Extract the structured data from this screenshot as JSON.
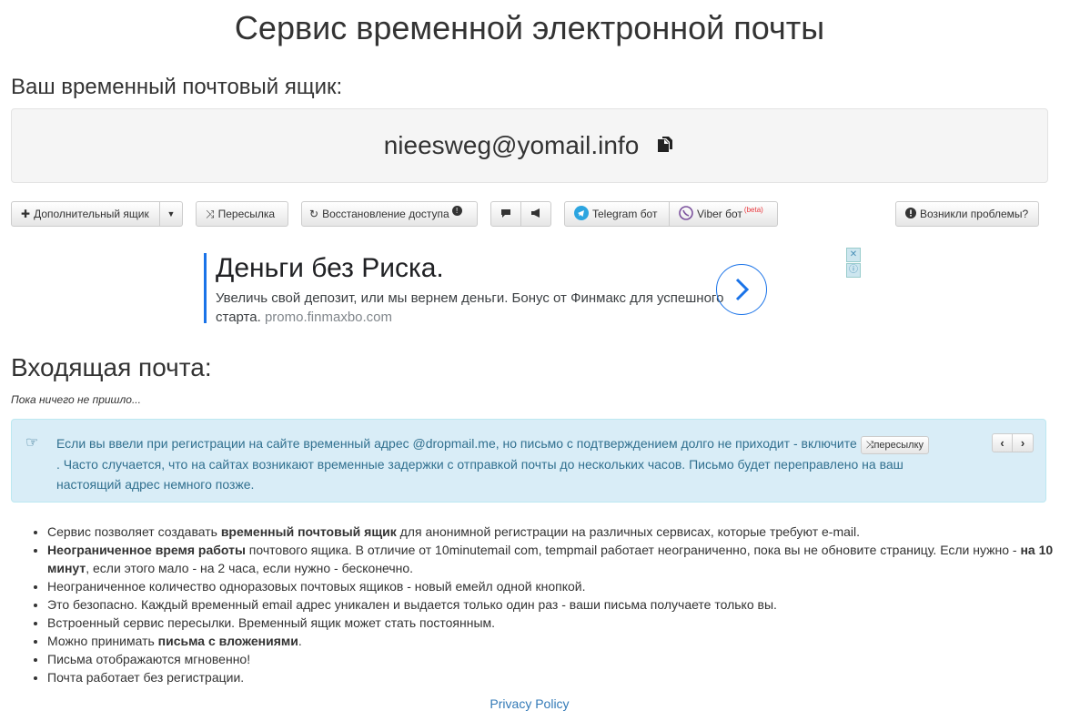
{
  "page": {
    "title": "Сервис временной электронной почты"
  },
  "mailbox": {
    "heading": "Ваш временный почтовый ящик:",
    "address": "nieesweg@yomail.info",
    "copy_icon": "copy-icon"
  },
  "toolbar": {
    "additional_box": "Дополнительный ящик",
    "forwarding": "Пересылка",
    "restore_access": "Восстановление доступа",
    "restore_badge": "!",
    "telegram_bot": "Telegram бот",
    "viber_bot": "Viber бот",
    "viber_beta": "(beta)",
    "problems": "Возникли проблемы?"
  },
  "ad": {
    "headline": "Деньги без Риска.",
    "body": "Увеличь свой депозит, или мы вернем деньги. Бонус от Финмакс для успешного старта.",
    "url": "promo.finmaxbo.com",
    "close_icon": "✕",
    "info_icon": "ⓘ"
  },
  "inbox": {
    "heading": "Входящая почта:",
    "empty_text": "Пока ничего не пришло..."
  },
  "info": {
    "text_before": "Если вы ввели при регистрации на сайте временный адрес @dropmail.me, но письмо с подтверждением долго не приходит - включите",
    "inline_button": "пересылку",
    "text_after": ". Часто случается, что на сайтах возникают временные задержки с отправкой почты до нескольких часов. Письмо будет переправлено на ваш настоящий адрес немного позже.",
    "prev": "‹",
    "next": "›"
  },
  "features": [
    {
      "pre": "Сервис позволяет создавать ",
      "bold": "временный почтовый ящик",
      "post": " для анонимной регистрации на различных сервисах, которые требуют e-mail."
    },
    {
      "pre": "",
      "bold": "Неограниченное время работы",
      "post": " почтового ящика. В отличие от 10minutemail com, tempmail работает неограниченно, пока вы не обновите страницу. Если нужно - ",
      "bold2": "на 10 минут",
      "post2": ", если этого мало - на 2 часа, если нужно - бесконечно."
    },
    {
      "pre": "Неограниченное количество одноразовых почтовых ящиков - новый емейл одной кнопкой.",
      "bold": "",
      "post": ""
    },
    {
      "pre": "Это безопасно. Каждый временный email адрес уникален и выдается только один раз - ваши письма получаете только вы.",
      "bold": "",
      "post": ""
    },
    {
      "pre": "Встроенный сервис пересылки. Временный ящик может стать постоянным.",
      "bold": "",
      "post": ""
    },
    {
      "pre": "Можно принимать ",
      "bold": "письма с вложениями",
      "post": "."
    },
    {
      "pre": "Письма отображаются мгновенно!",
      "bold": "",
      "post": ""
    },
    {
      "pre": "Почта работает без регистрации.",
      "bold": "",
      "post": ""
    }
  ],
  "footer": {
    "privacy": "Privacy Policy"
  },
  "colors": {
    "info_bg": "#d9edf7",
    "info_text": "#31708f",
    "link": "#337ab7",
    "ad_accent": "#1a73e8"
  }
}
